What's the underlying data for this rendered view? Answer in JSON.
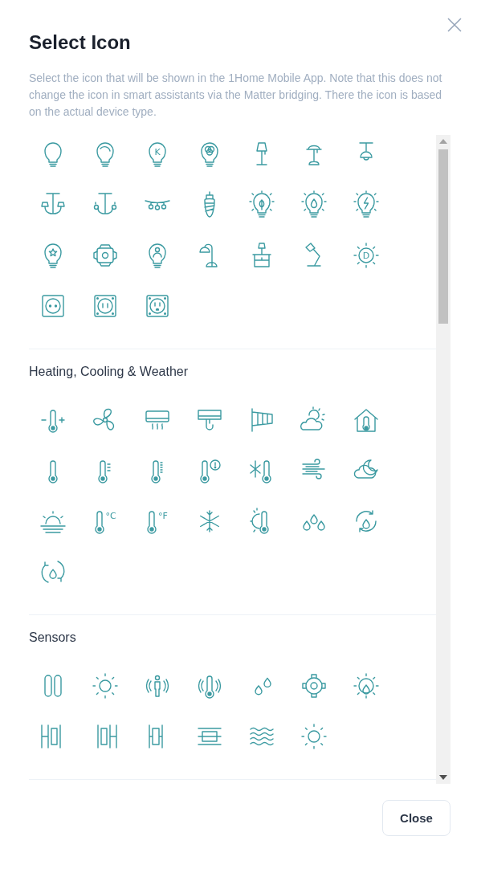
{
  "dialog": {
    "title": "Select Icon",
    "description": "Select the icon that will be shown in the 1Home Mobile App. Note that this does not change the icon in smart assistants via the Matter bridging. There the icon is based on the actual device type.",
    "sections": [
      {
        "icons": [
          {
            "kind": "bulb"
          },
          {
            "kind": "arc-bulb"
          },
          {
            "kind": "letter-bulb",
            "letter": "K"
          },
          {
            "kind": "color-bulb"
          },
          {
            "kind": "floor-lamp"
          },
          {
            "kind": "table-lamp"
          },
          {
            "kind": "pendant-lamp"
          },
          {
            "kind": "chandelier"
          },
          {
            "kind": "candle-chandelier"
          },
          {
            "kind": "string-lights"
          },
          {
            "kind": "corn-bulb"
          },
          {
            "kind": "leaf-bulb"
          },
          {
            "kind": "drop-bulb"
          },
          {
            "kind": "bolt-bulb"
          },
          {
            "kind": "star-bulb"
          },
          {
            "kind": "spotlight"
          },
          {
            "kind": "person-bulb"
          },
          {
            "kind": "desk-lamp"
          },
          {
            "kind": "nightstand-lamp"
          },
          {
            "kind": "arm-lamp"
          },
          {
            "kind": "letter-sun",
            "letter": "D"
          },
          {
            "kind": "socket"
          },
          {
            "kind": "framed-socket"
          },
          {
            "kind": "grounded-socket"
          }
        ]
      },
      {
        "heading": "Heating, Cooling & Weather",
        "icons": [
          {
            "kind": "thermometer-plus"
          },
          {
            "kind": "fan"
          },
          {
            "kind": "air-conditioner"
          },
          {
            "kind": "wall-unit"
          },
          {
            "kind": "windsock"
          },
          {
            "kind": "sun-cloud"
          },
          {
            "kind": "house-thermometer"
          },
          {
            "kind": "thermometer"
          },
          {
            "kind": "thermometer-scale"
          },
          {
            "kind": "thermometer-ticks"
          },
          {
            "kind": "thermometer-alert"
          },
          {
            "kind": "snow-thermometer"
          },
          {
            "kind": "wind"
          },
          {
            "kind": "moon-cloud"
          },
          {
            "kind": "sunrise"
          },
          {
            "kind": "unit-thermometer",
            "letter": "°C"
          },
          {
            "kind": "unit-thermometer",
            "letter": "°F"
          },
          {
            "kind": "snowflake"
          },
          {
            "kind": "sun-thermometer"
          },
          {
            "kind": "drops"
          },
          {
            "kind": "drop-cycle"
          },
          {
            "kind": "drop-arrows"
          }
        ]
      },
      {
        "heading": "Sensors",
        "icons": [
          {
            "kind": "contact-sensor"
          },
          {
            "kind": "sun"
          },
          {
            "kind": "presence"
          },
          {
            "kind": "thermometer-waves"
          },
          {
            "kind": "drop-pair"
          },
          {
            "kind": "ring-sensor"
          },
          {
            "kind": "sun-drop"
          },
          {
            "kind": "window-left"
          },
          {
            "kind": "window-right"
          },
          {
            "kind": "window-center"
          },
          {
            "kind": "slider-bar"
          },
          {
            "kind": "waves"
          },
          {
            "kind": "sun"
          }
        ]
      }
    ],
    "buttons": [
      "Close"
    ]
  }
}
